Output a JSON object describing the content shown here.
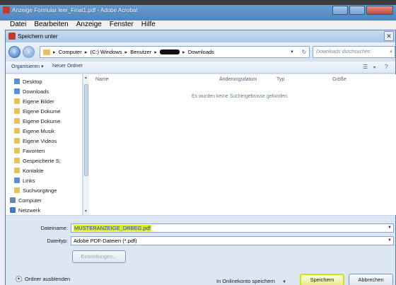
{
  "acrobat": {
    "title": "Anzeige Formular leer_Final1.pdf - Adobe Acrobat",
    "menu": [
      "Datei",
      "Bearbeiten",
      "Anzeige",
      "Fenster",
      "Hilfe"
    ]
  },
  "dialog": {
    "title": "Speichern unter",
    "close_glyph": "✕",
    "breadcrumb": [
      "Computer",
      "(C:) Windows",
      "Benutzer",
      "Downloads"
    ],
    "search_placeholder": "Downloads durchsuchen",
    "toolbar": {
      "organize": "Organisieren ▾",
      "new_folder": "Neuer Ordner"
    },
    "nav_items": [
      {
        "label": "Desktop",
        "icon": "folder-icon",
        "color": "blue"
      },
      {
        "label": "Downloads",
        "icon": "folder-icon",
        "color": "blue"
      },
      {
        "label": "Eigene Bilder",
        "icon": "folder-icon",
        "color": "fold"
      },
      {
        "label": "Eigene Dokume",
        "icon": "folder-icon",
        "color": "fold"
      },
      {
        "label": "Eigene Dokume",
        "icon": "folder-icon",
        "color": "fold"
      },
      {
        "label": "Eigene Musik",
        "icon": "folder-icon",
        "color": "fold"
      },
      {
        "label": "Eigene Videos",
        "icon": "folder-icon",
        "color": "fold"
      },
      {
        "label": "Favoriten",
        "icon": "folder-icon",
        "color": "fold"
      },
      {
        "label": "Gespeicherte S;",
        "icon": "folder-icon",
        "color": "fold"
      },
      {
        "label": "Kontakte",
        "icon": "folder-icon",
        "color": "fold"
      },
      {
        "label": "Links",
        "icon": "folder-icon",
        "color": "blue"
      },
      {
        "label": "Suchvorgänge",
        "icon": "folder-icon",
        "color": "fold"
      },
      {
        "label": "Computer",
        "icon": "computer-icon",
        "color": "pc"
      },
      {
        "label": "Netzwerk",
        "icon": "network-icon",
        "color": "net"
      }
    ],
    "columns": [
      "Name",
      "Änderungsdatum",
      "Typ",
      "Größe"
    ],
    "empty_message": "Es wurden keine Suchergebnisse gefunden.",
    "filename_label": "Dateiname:",
    "filename_value": "MUSTERANZEIGE_DRBEG.pdf",
    "filetype_label": "Dateityp:",
    "filetype_value": "Adobe PDF-Dateien (*.pdf)",
    "settings_button": "Einstellungen...",
    "hide_folders": "Ordner ausblenden",
    "online_save": "In Onlinekonto speichern",
    "save_button": "Speichern",
    "cancel_button": "Abbrechen"
  }
}
